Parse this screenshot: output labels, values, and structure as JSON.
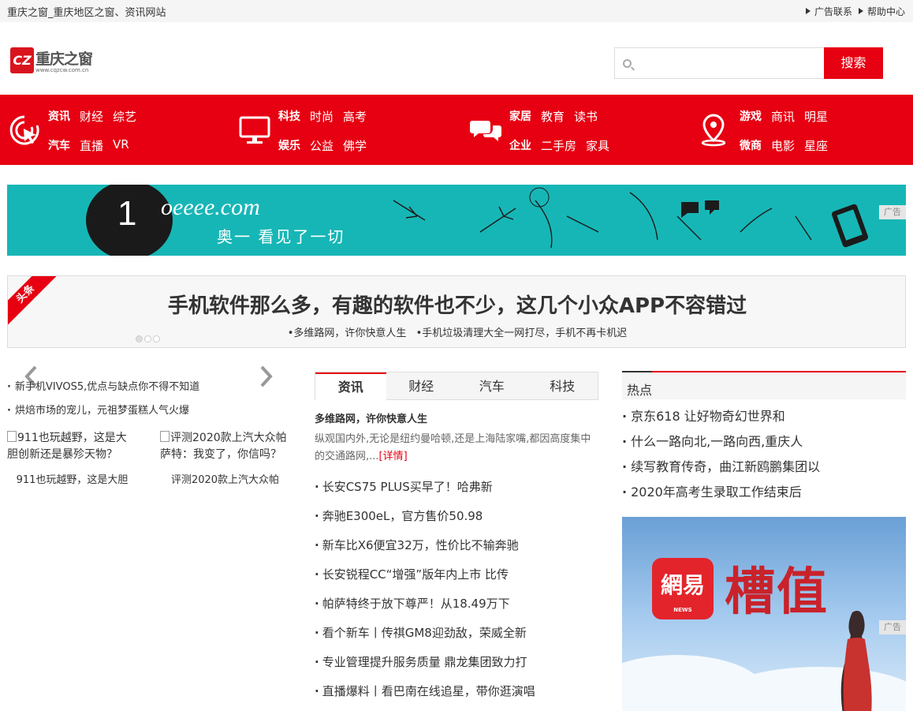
{
  "topbar": {
    "site_title": "重庆之窗_重庆地区之窗、资讯网站",
    "links": [
      "广告联系",
      "帮助中心"
    ]
  },
  "logo": {
    "badge": "CZ",
    "name": "重庆之窗",
    "url": "www.cqzcw.com.cn"
  },
  "search": {
    "value": "",
    "button": "搜索"
  },
  "nav": {
    "groups": [
      {
        "icon": "cursor-click-icon",
        "row1": [
          "资讯",
          "财经",
          "综艺"
        ],
        "row2": [
          "汽车",
          "直播",
          "VR"
        ]
      },
      {
        "icon": "monitor-icon",
        "row1": [
          "科技",
          "时尚",
          "高考"
        ],
        "row2": [
          "娱乐",
          "公益",
          "佛学"
        ]
      },
      {
        "icon": "chat-bubbles-icon",
        "row1": [
          "家居",
          "教育",
          "读书"
        ],
        "row2": [
          "企业",
          "二手房",
          "家具"
        ]
      },
      {
        "icon": "location-pin-icon",
        "row1": [
          "游戏",
          "商讯",
          "明星"
        ],
        "row2": [
          "微商",
          "电影",
          "星座"
        ]
      }
    ]
  },
  "banner": {
    "numeral": "1",
    "brand": "oeeee.com",
    "slogan": "奥一 看见了一切",
    "ad_label": "广告"
  },
  "headline": {
    "ribbon": "头条",
    "title": "手机软件那么多，有趣的软件也不少，这几个小众APP不容错过",
    "subs": [
      "•多维路网，许你快意人生",
      "•手机垃圾清理大全一网打尽，手机不再卡机迟"
    ]
  },
  "left": {
    "list": [
      "新手机VIVOS5,优点与缺点你不得不知道",
      "烘焙市场的宠儿，元祖梦蛋糕人气火爆"
    ],
    "thumbs": [
      {
        "alt": "911也玩越野，这是大胆创新还是暴殄天物？",
        "caption": "911也玩越野，这是大胆"
      },
      {
        "alt": "评测2020款上汽大众帕萨特：我变了，你信吗？",
        "caption": "评测2020款上汽大众帕"
      }
    ]
  },
  "middle": {
    "tabs": [
      "资讯",
      "财经",
      "汽车",
      "科技"
    ],
    "active_tab": 0,
    "lead_title": "多维路网，许你快意人生",
    "lead_desc": "纵观国内外,无论是纽约曼哈顿,还是上海陆家嘴,都因高度集中的交通路网,...",
    "more": "[详情]",
    "list": [
      "长安CS75 PLUS买早了！哈弗新",
      "奔驰E300eL，官方售价50.98",
      "新车比X6便宜32万，性价比不输奔驰",
      "长安锐程CC“增强”版年内上市 比传",
      "帕萨特终于放下尊严！从18.49万下",
      "看个新车丨传祺GM8迎劲敌，荣威全新",
      "专业管理提升服务质量 鼎龙集团致力打",
      "直播爆料丨看巴南在线追星，带你逛演唱"
    ]
  },
  "right": {
    "hot_title": "热点",
    "hot_list": [
      "京东618 让好物奇幻世界和",
      "什么一路向北,一路向西,重庆人",
      "续写教育传奇，曲江新鸥鹏集团以",
      "2020年高考生录取工作结束后"
    ],
    "ad": {
      "logo_text": "網易",
      "logo_sub": "NEWS",
      "big_text": "槽值",
      "ad_label": "广告"
    }
  },
  "colors": {
    "accent": "#e60012",
    "banner_bg": "#17b6b6"
  }
}
